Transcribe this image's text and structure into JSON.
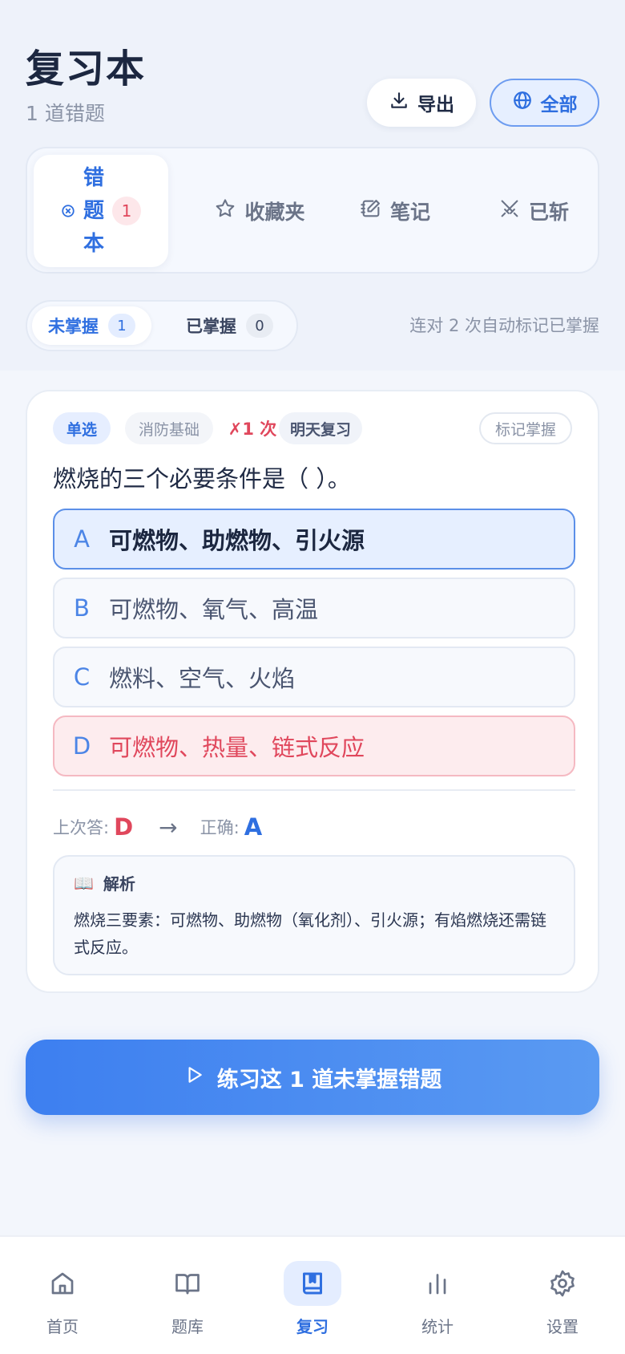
{
  "header": {
    "title": "复习本",
    "subtitle": "1 道错题",
    "export_label": "导出",
    "scope_label": "全部"
  },
  "segments": [
    {
      "label_chars": [
        "错",
        "题",
        "本"
      ],
      "count": "1",
      "icon": "x-circle-icon"
    },
    {
      "label": "收藏夹",
      "icon": "star-icon"
    },
    {
      "label": "笔记",
      "icon": "edit-icon"
    },
    {
      "label": "已斩",
      "icon": "swords-icon"
    }
  ],
  "filters": [
    {
      "label": "未掌握",
      "count": "1"
    },
    {
      "label": "已掌握",
      "count": "0"
    }
  ],
  "auto_hint": "连对 2 次自动标记已掌握",
  "question": {
    "type": "单选",
    "subject": "消防基础",
    "wrong_count": "✗1 次",
    "next_review": "明天复习",
    "mark_label": "标记掌握",
    "text": "燃烧的三个必要条件是（ ）。",
    "options": [
      {
        "letter": "A",
        "text": "可燃物、助燃物、引火源"
      },
      {
        "letter": "B",
        "text": "可燃物、氧气、高温"
      },
      {
        "letter": "C",
        "text": "燃料、空气、火焰"
      },
      {
        "letter": "D",
        "text": "可燃物、热量、链式反应"
      }
    ],
    "last_answer_label": "上次答:",
    "last_answer": "D",
    "arrow": "→",
    "correct_label": "正确:",
    "correct_answer": "A",
    "explanation_icon": "📖",
    "explanation_title": "解析",
    "explanation": "燃烧三要素：可燃物、助燃物（氧化剂）、引火源；有焰燃烧还需链式反应。"
  },
  "practice_button": "练习这 1 道未掌握错题",
  "nav": [
    {
      "label": "首页",
      "icon": "home-icon"
    },
    {
      "label": "题库",
      "icon": "book-icon"
    },
    {
      "label": "复习",
      "icon": "bookmark-book-icon"
    },
    {
      "label": "统计",
      "icon": "bar-chart-icon"
    },
    {
      "label": "设置",
      "icon": "gear-icon"
    }
  ],
  "colors": {
    "accent": "#2f6fe0",
    "danger": "#e0475c",
    "muted": "#8a93a6"
  }
}
